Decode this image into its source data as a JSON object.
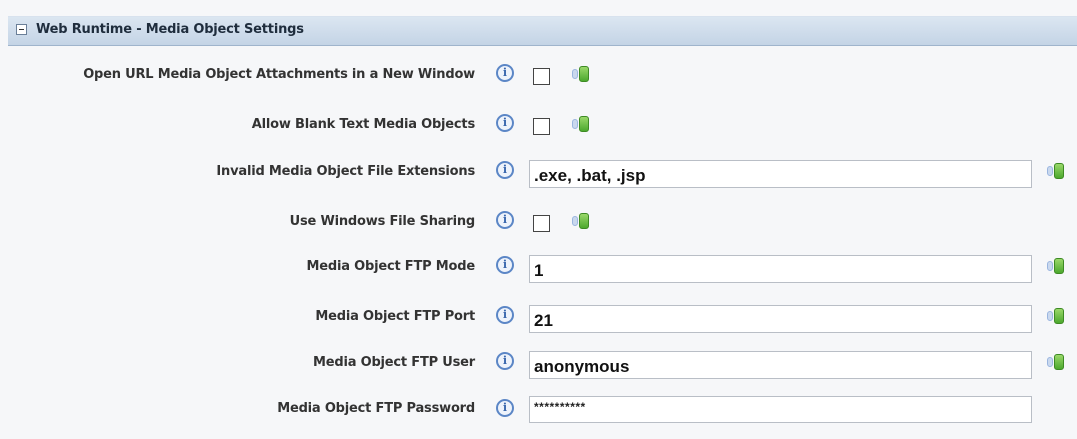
{
  "section": {
    "title": "Web Runtime - Media Object Settings"
  },
  "fields": [
    {
      "label": "Open URL Media Object Attachments in a New Window",
      "type": "checkbox",
      "checked": false
    },
    {
      "label": "Allow Blank Text Media Objects",
      "type": "checkbox",
      "checked": false
    },
    {
      "label": "Invalid Media Object File Extensions",
      "type": "text",
      "value": ".exe, .bat, .jsp"
    },
    {
      "label": "Use Windows File Sharing",
      "type": "checkbox",
      "checked": false
    },
    {
      "label": "Media Object FTP Mode",
      "type": "text",
      "value": "1"
    },
    {
      "label": "Media Object FTP Port",
      "type": "text",
      "value": "21"
    },
    {
      "label": "Media Object FTP User",
      "type": "text",
      "value": "anonymous"
    },
    {
      "label": "Media Object FTP Password",
      "type": "password",
      "value": "**********"
    }
  ],
  "icons": {
    "info": "info-icon",
    "toggle": "override-toggle-icon",
    "collapse": "collapse-icon"
  },
  "colors": {
    "header_bg": "#c4d4e6",
    "info_blue": "#5b86c6",
    "toggle_green": "#4ca82e"
  }
}
